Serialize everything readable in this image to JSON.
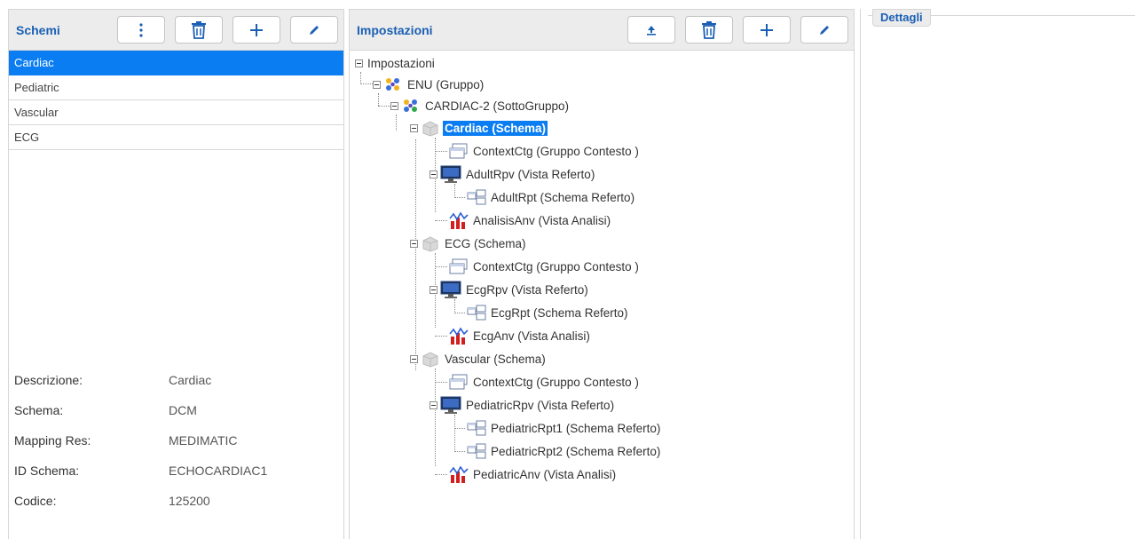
{
  "schemi": {
    "title": "Schemi",
    "items": [
      "Cardiac",
      "Pediatric",
      "Vascular",
      "ECG"
    ],
    "selected": "Cardiac",
    "details": [
      {
        "label": "Descrizione:",
        "value": "Cardiac"
      },
      {
        "label": "Schema:",
        "value": "DCM"
      },
      {
        "label": "Mapping Res:",
        "value": "MEDIMATIC"
      },
      {
        "label": "ID Schema:",
        "value": "ECHOCARDIAC1"
      },
      {
        "label": "Codice:",
        "value": "125200"
      }
    ]
  },
  "impostazioni": {
    "title": "Impostazioni",
    "tree": {
      "root": "Impostazioni",
      "group": "ENU (Gruppo)",
      "subgroup": "CARDIAC-2 (SottoGruppo)",
      "cardiac_schema": "Cardiac (Schema)",
      "cardiac_context": "ContextCtg (Gruppo Contesto )",
      "adult_rpv": "AdultRpv (Vista Referto)",
      "adult_rpt": "AdultRpt (Schema Referto)",
      "analisis_anv": "AnalisisAnv (Vista Analisi)",
      "ecg_schema": "ECG (Schema)",
      "ecg_context": "ContextCtg (Gruppo Contesto )",
      "ecg_rpv": "EcgRpv (Vista Referto)",
      "ecg_rpt": "EcgRpt (Schema Referto)",
      "ecg_anv": "EcgAnv (Vista Analisi)",
      "vascular_schema": "Vascular (Schema)",
      "vascular_context": "ContextCtg (Gruppo Contesto )",
      "pediatric_rpv": "PediatricRpv (Vista Referto)",
      "pediatric_rpt1": "PediatricRpt1 (Schema Referto)",
      "pediatric_rpt2": "PediatricRpt2 (Schema Referto)",
      "pediatric_anv": "PediatricAnv (Vista Analisi)"
    },
    "selected_node": "Cardiac (Schema)"
  },
  "dettagli": {
    "title": "Dettagli"
  },
  "icons": {
    "menu": "vertical-dots-icon",
    "delete": "trash-icon",
    "add": "plus-icon",
    "edit": "pencil-icon",
    "upload": "upload-icon"
  },
  "colors": {
    "accent": "#1a5fb4",
    "selection": "#0a7df2",
    "header_bg": "#ececec"
  }
}
